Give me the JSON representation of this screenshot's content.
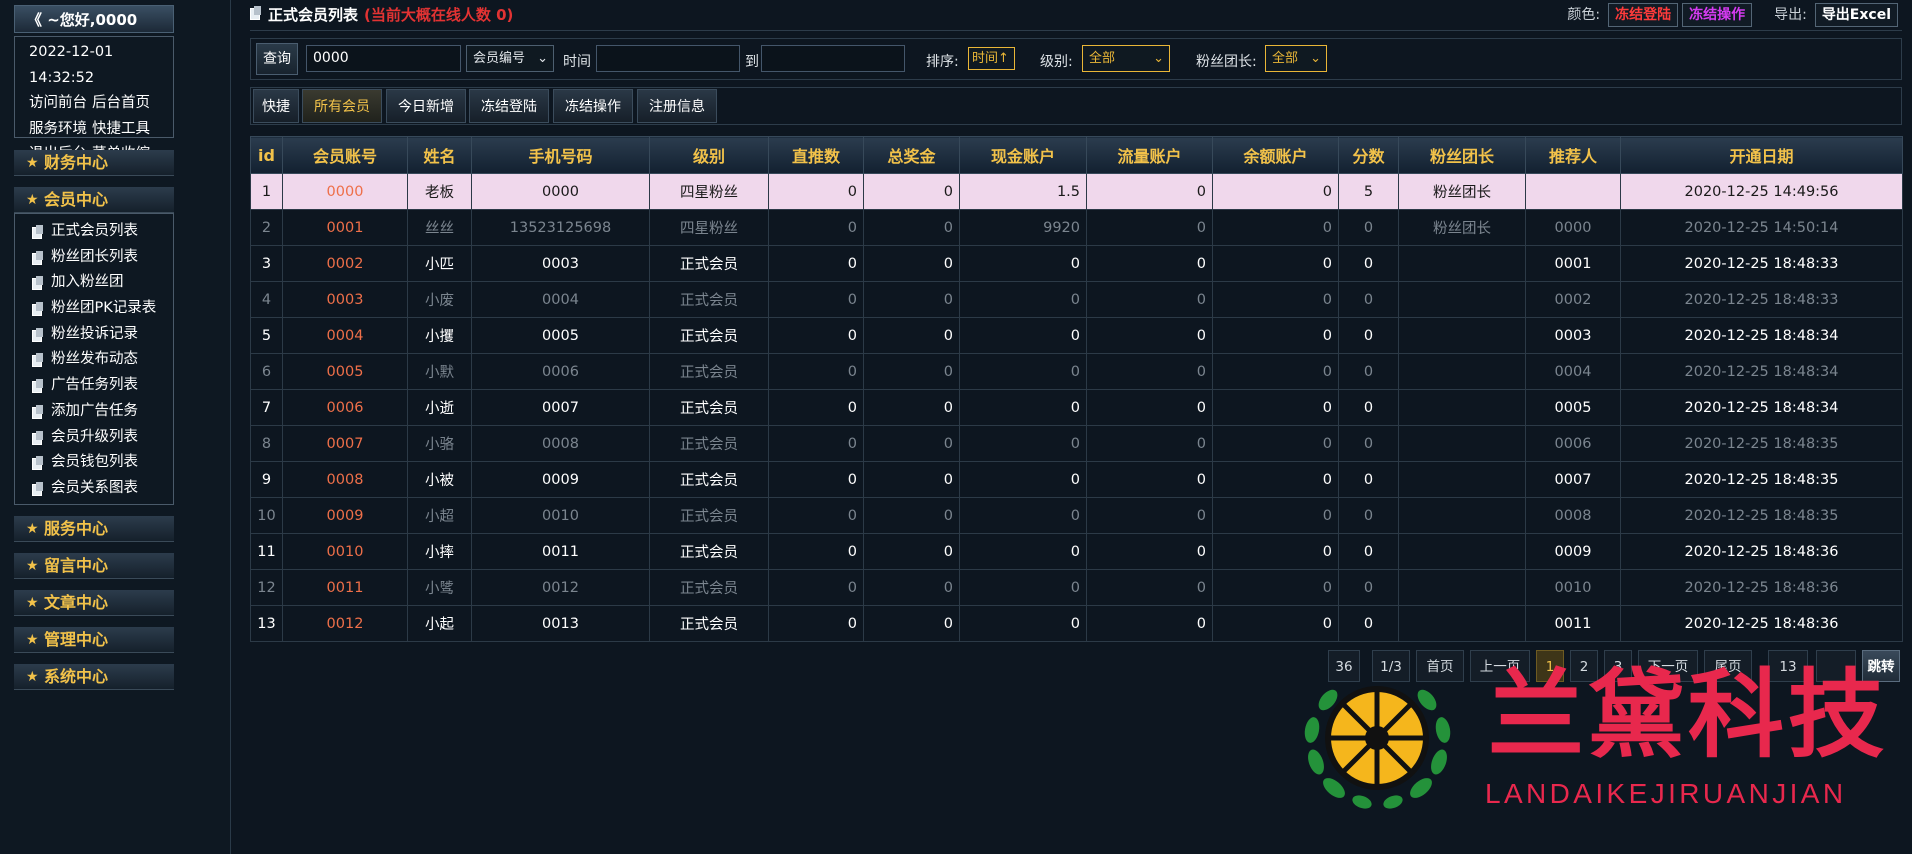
{
  "sidebar": {
    "greeting": "《 ~您好,0000",
    "datetime": "2022-12-01 14:32:52",
    "links": [
      "访问前台",
      "后台首页",
      "服务环境",
      "快捷工具",
      "退出后台",
      "菜单收缩"
    ],
    "groups": [
      "财务中心",
      "会员中心",
      "服务中心",
      "留言中心",
      "文章中心",
      "管理中心",
      "系统中心"
    ],
    "member_items": [
      "正式会员列表",
      "粉丝团长列表",
      "加入粉丝团",
      "粉丝团PK记录表",
      "粉丝投诉记录",
      "粉丝发布动态",
      "广告任务列表",
      "添加广告任务",
      "会员升级列表",
      "会员钱包列表",
      "会员关系图表"
    ]
  },
  "header": {
    "title": "正式会员列表",
    "online": "(当前大概在线人数 0)",
    "color_label": "颜色:",
    "freeze_login": "冻结登陆",
    "freeze_op": "冻结操作",
    "export_label": "导出:",
    "export_excel": "导出Excel"
  },
  "search": {
    "query_btn": "查询",
    "keyword": "0000",
    "field_select": "会员编号",
    "time_label": "时间",
    "to_label": "到",
    "sort_label": "排序:",
    "sort_value": "时间↑",
    "level_label": "级别:",
    "level_value": "全部",
    "fan_label": "粉丝团长:",
    "fan_value": "全部"
  },
  "tabs": [
    "快捷",
    "所有会员",
    "今日新增",
    "冻结登陆",
    "冻结操作",
    "注册信息"
  ],
  "table": {
    "headers": [
      "id",
      "会员账号",
      "姓名",
      "手机号码",
      "级别",
      "直推数",
      "总奖金",
      "现金账户",
      "流量账户",
      "余额账户",
      "分数",
      "粉丝团长",
      "推荐人",
      "开通日期"
    ],
    "rows": [
      [
        "1",
        "0000",
        "老板",
        "0000",
        "四星粉丝",
        "0",
        "0",
        "1.5",
        "0",
        "0",
        "5",
        "粉丝团长",
        "",
        "2020-12-25 14:49:56"
      ],
      [
        "2",
        "0001",
        "丝丝",
        "13523125698",
        "四星粉丝",
        "0",
        "0",
        "9920",
        "0",
        "0",
        "0",
        "粉丝团长",
        "0000",
        "2020-12-25 14:50:14"
      ],
      [
        "3",
        "0002",
        "小匹",
        "0003",
        "正式会员",
        "0",
        "0",
        "0",
        "0",
        "0",
        "0",
        "",
        "0001",
        "2020-12-25 18:48:33"
      ],
      [
        "4",
        "0003",
        "小废",
        "0004",
        "正式会员",
        "0",
        "0",
        "0",
        "0",
        "0",
        "0",
        "",
        "0002",
        "2020-12-25 18:48:33"
      ],
      [
        "5",
        "0004",
        "小攫",
        "0005",
        "正式会员",
        "0",
        "0",
        "0",
        "0",
        "0",
        "0",
        "",
        "0003",
        "2020-12-25 18:48:34"
      ],
      [
        "6",
        "0005",
        "小默",
        "0006",
        "正式会员",
        "0",
        "0",
        "0",
        "0",
        "0",
        "0",
        "",
        "0004",
        "2020-12-25 18:48:34"
      ],
      [
        "7",
        "0006",
        "小逝",
        "0007",
        "正式会员",
        "0",
        "0",
        "0",
        "0",
        "0",
        "0",
        "",
        "0005",
        "2020-12-25 18:48:34"
      ],
      [
        "8",
        "0007",
        "小骆",
        "0008",
        "正式会员",
        "0",
        "0",
        "0",
        "0",
        "0",
        "0",
        "",
        "0006",
        "2020-12-25 18:48:35"
      ],
      [
        "9",
        "0008",
        "小被",
        "0009",
        "正式会员",
        "0",
        "0",
        "0",
        "0",
        "0",
        "0",
        "",
        "0007",
        "2020-12-25 18:48:35"
      ],
      [
        "10",
        "0009",
        "小超",
        "0010",
        "正式会员",
        "0",
        "0",
        "0",
        "0",
        "0",
        "0",
        "",
        "0008",
        "2020-12-25 18:48:35"
      ],
      [
        "11",
        "0010",
        "小摔",
        "0011",
        "正式会员",
        "0",
        "0",
        "0",
        "0",
        "0",
        "0",
        "",
        "0009",
        "2020-12-25 18:48:36"
      ],
      [
        "12",
        "0011",
        "小骘",
        "0012",
        "正式会员",
        "0",
        "0",
        "0",
        "0",
        "0",
        "0",
        "",
        "0010",
        "2020-12-25 18:48:36"
      ],
      [
        "13",
        "0012",
        "小起",
        "0013",
        "正式会员",
        "0",
        "0",
        "0",
        "0",
        "0",
        "0",
        "",
        "0011",
        "2020-12-25 18:48:36"
      ]
    ]
  },
  "pager": {
    "total": "36",
    "pages": "1/3",
    "first": "首页",
    "prev": "上一页",
    "p1": "1",
    "p2": "2",
    "p3": "3",
    "next": "下一页",
    "last": "尾页",
    "jump_value": "13",
    "go": "跳转"
  },
  "watermark": {
    "name": "兰黛科技",
    "sub": "LANDAIKEJIRUANJIAN"
  },
  "colors": {
    "accent": "#f2c24a",
    "account": "#ee6f49",
    "highlight_row": "#f0d8ec",
    "watermark": "#e8284d"
  }
}
